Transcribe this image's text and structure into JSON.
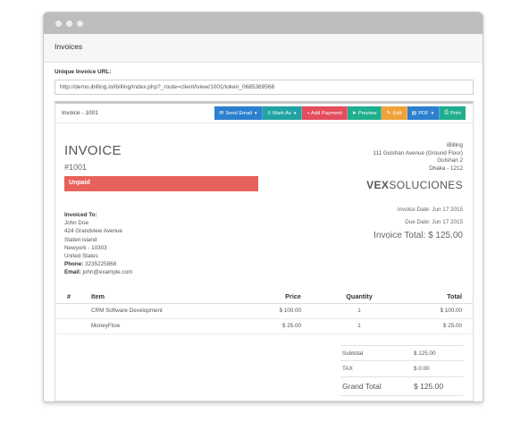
{
  "header": {
    "title": "Invoices"
  },
  "url": {
    "label": "Unique Invoice URL:",
    "value": "http://demo.ibilling.io/ibilling/index.php?_route=client/iview/1001/token_0685369568"
  },
  "panel": {
    "title": "Invoice - 1001"
  },
  "toolbar": {
    "send_email": "Send Email",
    "mark_as": "Mark As",
    "add_payment": "+ Add Payment",
    "preview": "Preview",
    "edit": "Edit",
    "pdf": "PDF",
    "print": "Print"
  },
  "invoice": {
    "heading": "INVOICE",
    "number": "#1001",
    "status": "Unpaid",
    "invoice_date": "Invoice Date: Jun 17 2015",
    "due_date": "Due Date: Jun 17 2015",
    "total_line": "Invoice Total: $ 125.00"
  },
  "company": {
    "name": "iBilling",
    "address1": "111 Gulshan Avenue (Ground Floor)",
    "address2": "Gulshan 2",
    "address3": "Dhaka - 1212",
    "logo_bold": "VEX",
    "logo_rest": "SOLUCIONES"
  },
  "client": {
    "label": "Invoiced To:",
    "name": "John Doe",
    "street": "424 Grandview Avenue",
    "area": "Staten island",
    "city": "Newyork - 10303",
    "country": "United States",
    "phone_label": "Phone:",
    "phone": "3235225868",
    "email_label": "Email:",
    "email": "john@example.com"
  },
  "table": {
    "headers": {
      "hash": "#",
      "item": "Item",
      "price": "Price",
      "qty": "Quantity",
      "total": "Total"
    },
    "rows": [
      {
        "item": "CRM Software Development",
        "price": "$ 100.00",
        "qty": "1",
        "total": "$ 100.00"
      },
      {
        "item": "MoneyFlow",
        "price": "$ 25.00",
        "qty": "1",
        "total": "$ 25.00"
      }
    ]
  },
  "summary": {
    "subtotal_label": "Subtotal",
    "subtotal": "$ 125.00",
    "tax_label": "TAX",
    "tax": "$ 0.00",
    "grand_label": "Grand Total",
    "grand": "$ 125.00"
  },
  "icons": {
    "send_email": "envelope-icon",
    "mark_as": "bars-icon",
    "preview": "paper-plane-icon",
    "edit": "pencil-icon",
    "pdf": "file-icon",
    "print": "printer-icon"
  },
  "colors": {
    "send": "#2d7fcf",
    "mark": "#21a3a3",
    "add": "#e44d5d",
    "preview": "#1fae8e",
    "edit": "#f0a23a",
    "status": "#e8625c"
  }
}
